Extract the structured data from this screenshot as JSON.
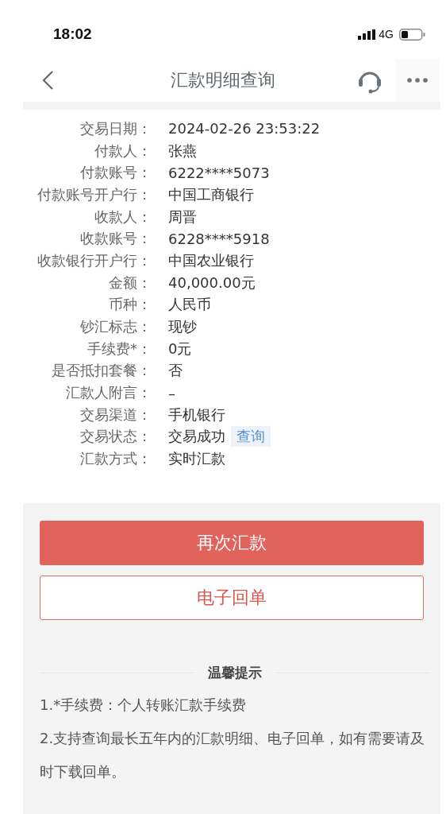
{
  "status_bar": {
    "time": "18:02",
    "network": "4G"
  },
  "header": {
    "title": "汇款明细查询"
  },
  "details": [
    {
      "label": "交易日期：",
      "value": "2024-02-26 23:53:22"
    },
    {
      "label": "付款人：",
      "value": "张燕"
    },
    {
      "label": "付款账号：",
      "value": "6222****5073"
    },
    {
      "label": "付款账号开户行：",
      "value": "中国工商银行"
    },
    {
      "label": "收款人：",
      "value": "周晋"
    },
    {
      "label": "收款账号：",
      "value": "6228****5918"
    },
    {
      "label": "收款银行开户行：",
      "value": "中国农业银行"
    },
    {
      "label": "金额：",
      "value": "40,000.00元"
    },
    {
      "label": "币种：",
      "value": "人民币"
    },
    {
      "label": "钞汇标志：",
      "value": "现钞"
    },
    {
      "label": "手续费*：",
      "value": "0元"
    },
    {
      "label": "是否抵扣套餐：",
      "value": "否"
    },
    {
      "label": "汇款人附言：",
      "value": "–"
    },
    {
      "label": "交易渠道：",
      "value": "手机银行"
    },
    {
      "label": "交易状态：",
      "value": "交易成功",
      "action": "查询"
    },
    {
      "label": "汇款方式：",
      "value": "实时汇款"
    }
  ],
  "buttons": [
    {
      "label": "再次汇款",
      "kind": "primary"
    },
    {
      "label": "电子回单",
      "kind": "outline"
    }
  ],
  "tips": {
    "title": "温馨提示",
    "items": [
      "1.*手续费：个人转账汇款手续费",
      "2.支持查询最长五年内的汇款明细、电子回单，如有需要请及时下载回单。"
    ]
  }
}
